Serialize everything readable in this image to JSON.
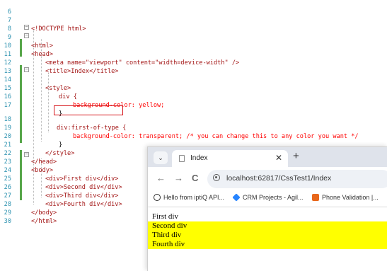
{
  "editor": {
    "lines": [
      {
        "n": "6",
        "code": ""
      },
      {
        "n": "7",
        "code": "<!DOCTYPE html>"
      },
      {
        "n": "8",
        "code": ""
      },
      {
        "n": "9",
        "code": "<html>"
      },
      {
        "n": "10",
        "code": "<head>"
      },
      {
        "n": "11",
        "code": "<meta name=\"viewport\" content=\"width=device-width\" />"
      },
      {
        "n": "12",
        "code": "<title>Index</title>"
      },
      {
        "n": "13",
        "code": ""
      },
      {
        "n": "14",
        "code": "<style>"
      },
      {
        "n": "15",
        "code": "div {"
      },
      {
        "n": "16",
        "code": "background-color: yellow;"
      },
      {
        "n": "17",
        "code": "}"
      },
      {
        "n": "18",
        "code": "div:first-of-type {"
      },
      {
        "n": "19",
        "code": "background-color: transparent; /* you can change this to any color you want */"
      },
      {
        "n": "20",
        "code": "}"
      },
      {
        "n": "21",
        "code": "</style>"
      },
      {
        "n": "22",
        "code": "</head>"
      },
      {
        "n": "23",
        "code": "<body>"
      },
      {
        "n": "24",
        "code": "<div>First div</div>"
      },
      {
        "n": "25",
        "code": "<div>Second div</div>"
      },
      {
        "n": "26",
        "code": "<div>Third div</div>"
      },
      {
        "n": "27",
        "code": "<div>Fourth div</div>"
      },
      {
        "n": "28",
        "code": "</body>"
      },
      {
        "n": "29",
        "code": "</html>"
      },
      {
        "n": "30",
        "code": ""
      }
    ],
    "highlight_color": "#d6141a",
    "change_bar_color": "#57a64a"
  },
  "browser": {
    "tab_menu": "⌄",
    "tab_title": "Index",
    "tab_close": "✕",
    "new_tab": "+",
    "back": "←",
    "forward": "→",
    "reload": "C",
    "url": "localhost:62817/CssTest1/Index",
    "bookmarks": [
      {
        "label": "Hello from iptiQ API...",
        "icon": "q-logo-icon",
        "color": "#2a2a2a"
      },
      {
        "label": "CRM Projects - Agil...",
        "icon": "diamond-icon",
        "color": "#2684ff"
      },
      {
        "label": "Phone Validation |...",
        "icon": "b-logo-icon",
        "color": "#e8671b"
      }
    ],
    "page_divs": [
      {
        "text": "First div",
        "bg": "transparent"
      },
      {
        "text": "Second div",
        "bg": "#ffff00"
      },
      {
        "text": "Third div",
        "bg": "#ffff00"
      },
      {
        "text": "Fourth div",
        "bg": "#ffff00"
      }
    ]
  }
}
